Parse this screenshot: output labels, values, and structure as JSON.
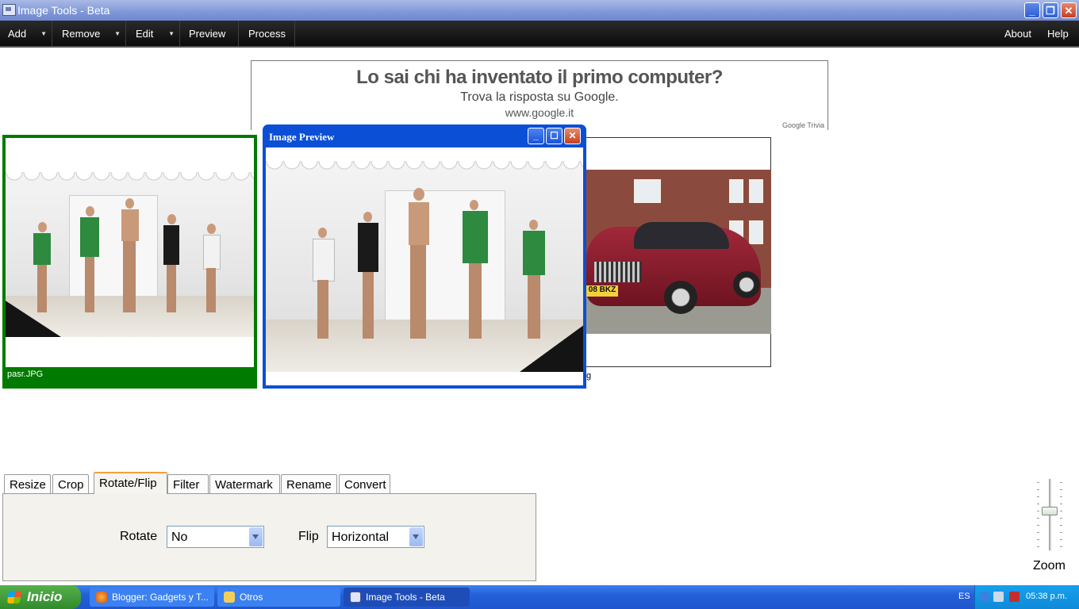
{
  "window": {
    "title": "Image Tools - Beta",
    "controls": {
      "minimize": "_",
      "restore": "❐",
      "close": "✕"
    }
  },
  "menu": {
    "add": "Add",
    "remove": "Remove",
    "edit": "Edit",
    "preview": "Preview",
    "process": "Process",
    "about": "About",
    "help": "Help",
    "dropdown_glyph": "▼"
  },
  "ad": {
    "headline": "Lo sai chi ha inventato il primo computer?",
    "line2": "Trova la risposta su Google.",
    "line3": "www.google.it",
    "small": "Google Trivia"
  },
  "thumbnails": [
    {
      "caption": "pasr.JPG",
      "selected": true
    },
    {
      "caption": "g",
      "selected": false
    }
  ],
  "photo": {
    "plate": "08 BKZ"
  },
  "preview_window": {
    "title": "Image Preview",
    "controls": {
      "minimize": "_",
      "maximize": "☐",
      "close": "✕"
    }
  },
  "tabs": [
    {
      "label": "Resize"
    },
    {
      "label": "Crop"
    },
    {
      "label": "Rotate/Flip"
    },
    {
      "label": "Filter"
    },
    {
      "label": "Watermark"
    },
    {
      "label": "Rename"
    },
    {
      "label": "Convert"
    }
  ],
  "active_tab": "Rotate/Flip",
  "rotate_flip": {
    "rotate_label": "Rotate",
    "rotate_value": "No",
    "flip_label": "Flip",
    "flip_value": "Horizontal"
  },
  "zoom": {
    "label": "Zoom",
    "level_fraction": 0.58
  },
  "taskbar": {
    "start_label": "Inicio",
    "tasks": [
      {
        "label": "Blogger: Gadgets y T...",
        "active": false
      },
      {
        "label": "Otros",
        "active": false
      },
      {
        "label": "Image Tools - Beta",
        "active": true
      }
    ],
    "language": "ES",
    "clock": "05:38 p.m."
  },
  "colors": {
    "selection_green": "#007a00",
    "menubar": "#111111",
    "preview_frame": "#0b4fd6",
    "active_tab_accent": "#f2a23a"
  }
}
